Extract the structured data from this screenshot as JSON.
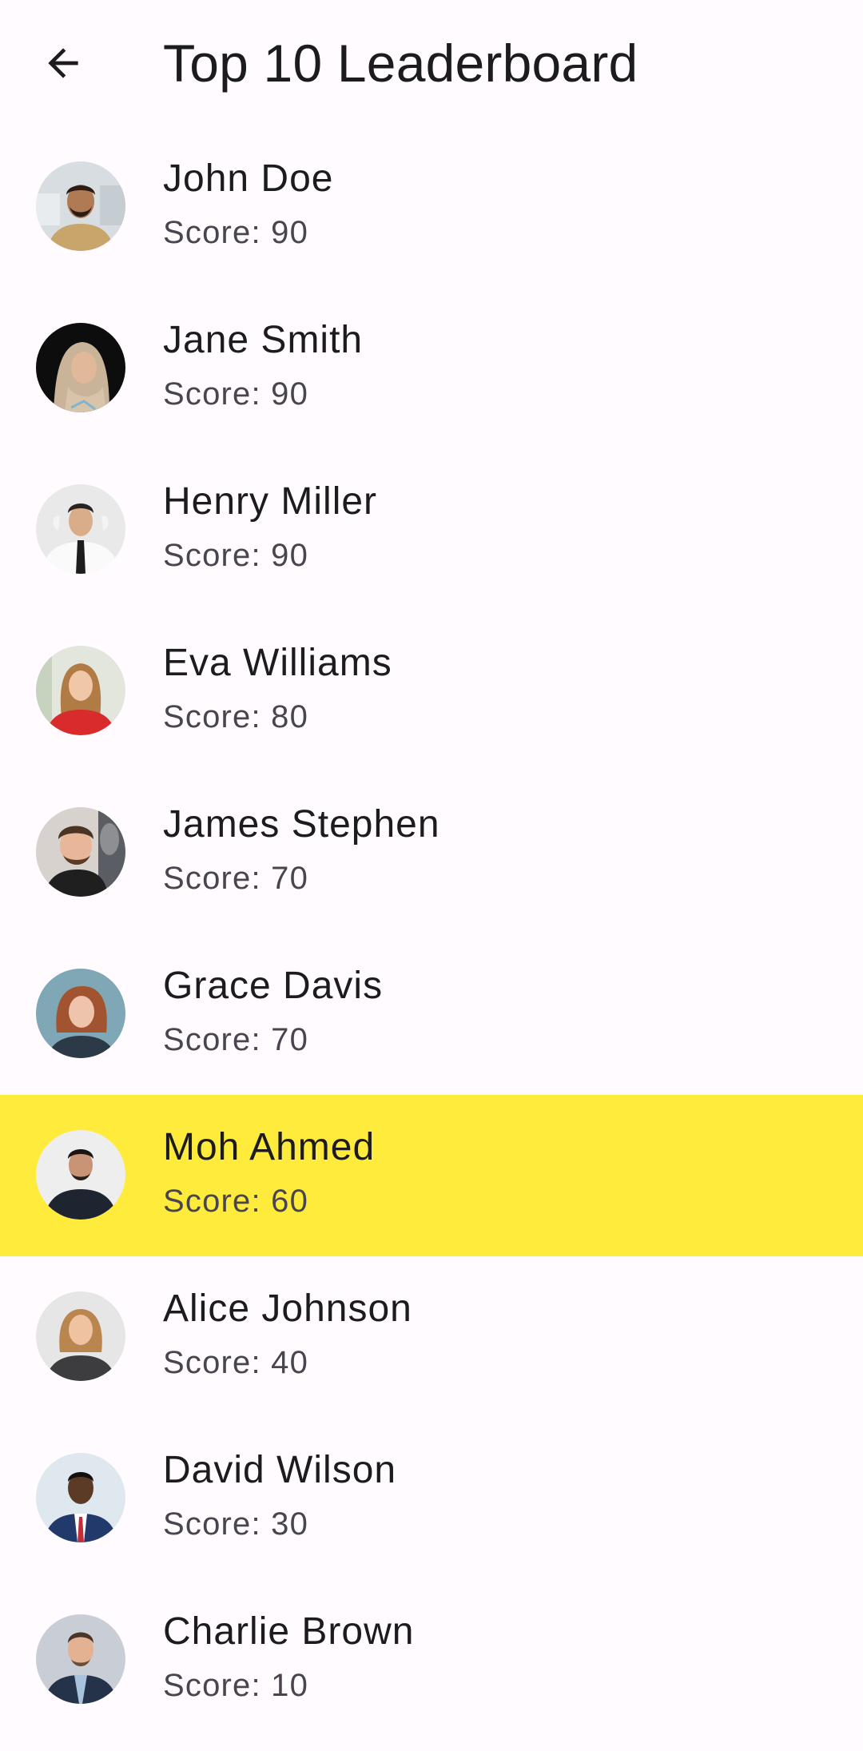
{
  "header": {
    "title": "Top 10 Leaderboard",
    "back_icon": "arrow-left-icon"
  },
  "colors": {
    "background": "#fffbfe",
    "highlight": "#ffeb3b",
    "text_primary": "#1c1b1f",
    "text_secondary": "#49454f"
  },
  "leaderboard": [
    {
      "name": "John Doe",
      "score": "Score: 90",
      "highlighted": false
    },
    {
      "name": "Jane Smith",
      "score": "Score: 90",
      "highlighted": false
    },
    {
      "name": "Henry Miller",
      "score": "Score: 90",
      "highlighted": false
    },
    {
      "name": "Eva Williams",
      "score": "Score: 80",
      "highlighted": false
    },
    {
      "name": "James Stephen",
      "score": "Score: 70",
      "highlighted": false
    },
    {
      "name": "Grace Davis",
      "score": "Score: 70",
      "highlighted": false
    },
    {
      "name": "Moh Ahmed",
      "score": "Score: 60",
      "highlighted": true
    },
    {
      "name": "Alice Johnson",
      "score": "Score: 40",
      "highlighted": false
    },
    {
      "name": "David Wilson",
      "score": "Score: 30",
      "highlighted": false
    },
    {
      "name": "Charlie Brown",
      "score": "Score: 10",
      "highlighted": false
    }
  ]
}
